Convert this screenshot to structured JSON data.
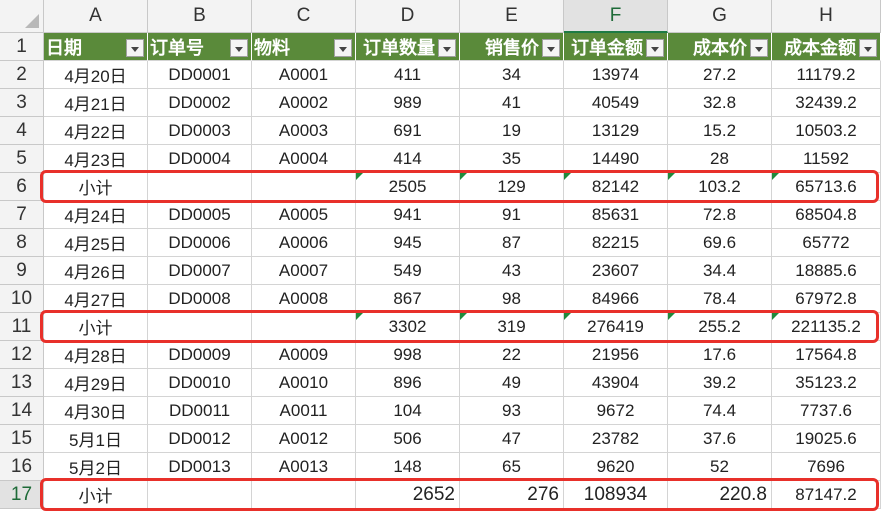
{
  "columns": [
    "A",
    "B",
    "C",
    "D",
    "E",
    "F",
    "G",
    "H"
  ],
  "selected_column": "F",
  "row_numbers": [
    "1",
    "2",
    "3",
    "4",
    "5",
    "6",
    "7",
    "8",
    "9",
    "10",
    "11",
    "12",
    "13",
    "14",
    "15",
    "16",
    "17"
  ],
  "active_row": "17",
  "header_row": [
    "日期",
    "订单号",
    "物料",
    "订单数量",
    "销售价",
    "订单金额",
    "成本价",
    "成本金额"
  ],
  "data_rows": [
    [
      "4月20日",
      "DD0001",
      "A0001",
      "411",
      "34",
      "13974",
      "27.2",
      "11179.2"
    ],
    [
      "4月21日",
      "DD0002",
      "A0002",
      "989",
      "41",
      "40549",
      "32.8",
      "32439.2"
    ],
    [
      "4月22日",
      "DD0003",
      "A0003",
      "691",
      "19",
      "13129",
      "15.2",
      "10503.2"
    ],
    [
      "4月23日",
      "DD0004",
      "A0004",
      "414",
      "35",
      "14490",
      "28",
      "11592"
    ],
    [
      "小计",
      "",
      "",
      "2505",
      "129",
      "82142",
      "103.2",
      "65713.6"
    ],
    [
      "4月24日",
      "DD0005",
      "A0005",
      "941",
      "91",
      "85631",
      "72.8",
      "68504.8"
    ],
    [
      "4月25日",
      "DD0006",
      "A0006",
      "945",
      "87",
      "82215",
      "69.6",
      "65772"
    ],
    [
      "4月26日",
      "DD0007",
      "A0007",
      "549",
      "43",
      "23607",
      "34.4",
      "18885.6"
    ],
    [
      "4月27日",
      "DD0008",
      "A0008",
      "867",
      "98",
      "84966",
      "78.4",
      "67972.8"
    ],
    [
      "小计",
      "",
      "",
      "3302",
      "319",
      "276419",
      "255.2",
      "221135.2"
    ],
    [
      "4月28日",
      "DD0009",
      "A0009",
      "998",
      "22",
      "21956",
      "17.6",
      "17564.8"
    ],
    [
      "4月29日",
      "DD0010",
      "A0010",
      "896",
      "49",
      "43904",
      "39.2",
      "35123.2"
    ],
    [
      "4月30日",
      "DD0011",
      "A0011",
      "104",
      "93",
      "9672",
      "74.4",
      "7737.6"
    ],
    [
      "5月1日",
      "DD0012",
      "A0012",
      "506",
      "47",
      "23782",
      "37.6",
      "19025.6"
    ],
    [
      "5月2日",
      "DD0013",
      "A0013",
      "148",
      "65",
      "9620",
      "52",
      "7696"
    ],
    [
      "小计",
      "",
      "",
      "2652",
      "276",
      "108934",
      "220.8",
      "87147.2"
    ]
  ],
  "colors": {
    "header_fill": "#5a8a3a",
    "highlight_border": "#e8302a",
    "selection": "#1e7b44",
    "formula_marker": "#1f8a3c"
  }
}
